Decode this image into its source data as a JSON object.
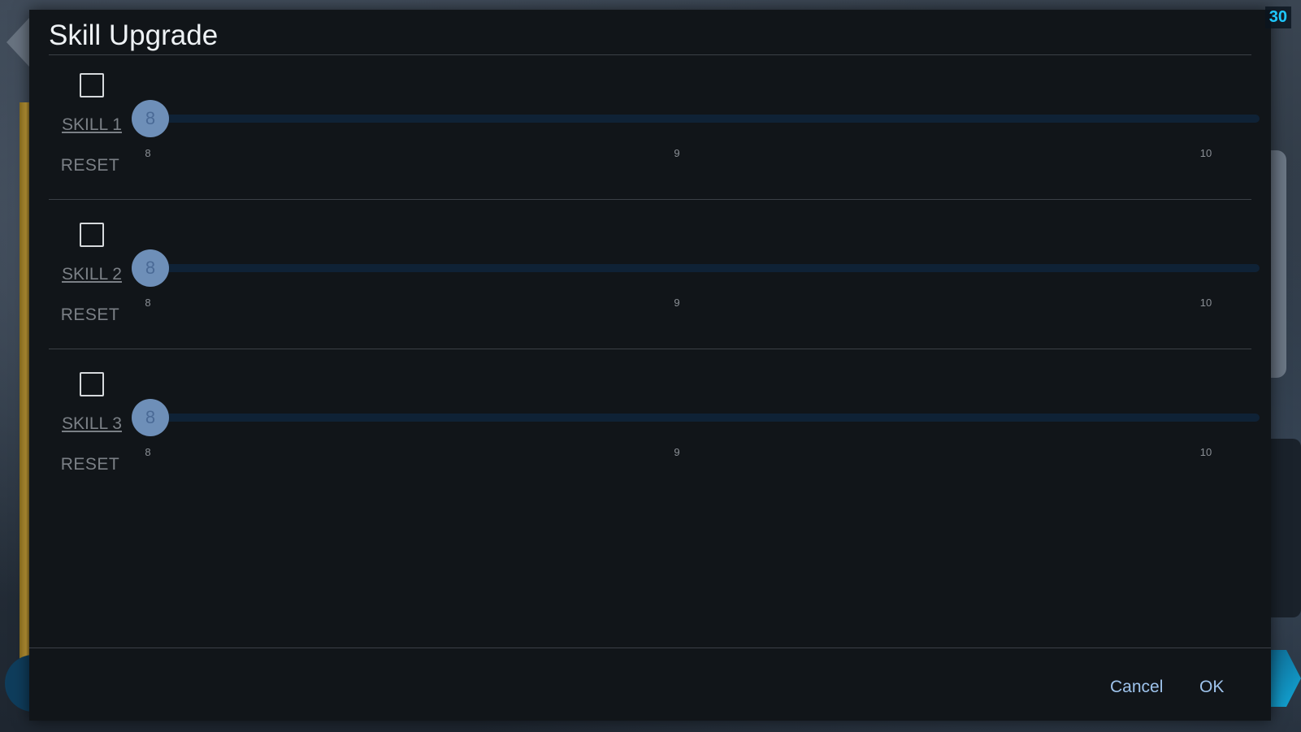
{
  "hud": {
    "fps": "30"
  },
  "dialog": {
    "title": "Skill Upgrade",
    "skills": [
      {
        "name": "SKILL 1",
        "checked": false,
        "value": "8",
        "min": "8",
        "mid": "9",
        "max": "10",
        "reset_label": "RESET"
      },
      {
        "name": "SKILL 2",
        "checked": false,
        "value": "8",
        "min": "8",
        "mid": "9",
        "max": "10",
        "reset_label": "RESET"
      },
      {
        "name": "SKILL 3",
        "checked": false,
        "value": "8",
        "min": "8",
        "mid": "9",
        "max": "10",
        "reset_label": "RESET"
      }
    ],
    "footer": {
      "cancel_label": "Cancel",
      "ok_label": "OK"
    }
  },
  "colors": {
    "dialog_bg": "#111519",
    "accent": "#9ec3ec",
    "slider_thumb": "#6e8fb8",
    "slider_track": "#0f2236",
    "fps_text": "#1ec8ff"
  },
  "icons": [
    "left-arrow-icon",
    "checkbox-icon"
  ]
}
